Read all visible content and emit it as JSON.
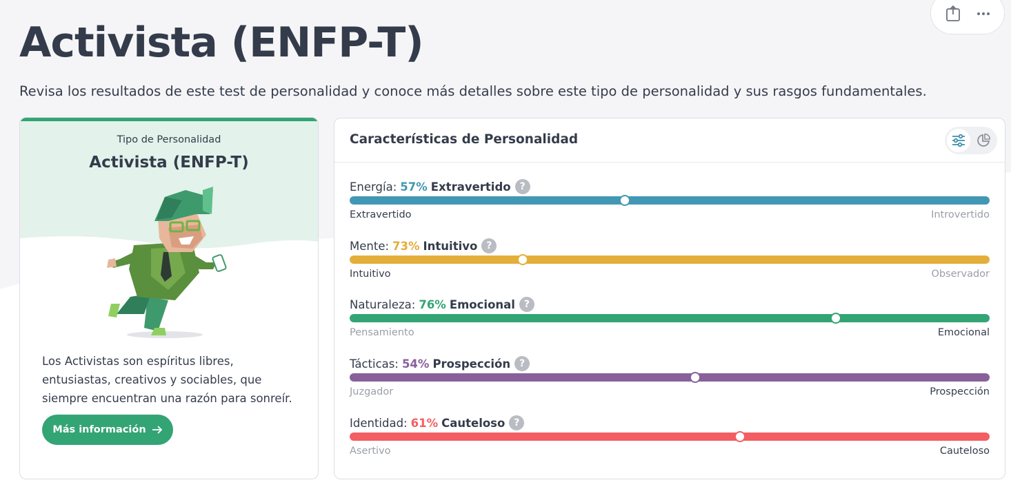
{
  "page": {
    "title": "Activista (ENFP-T)",
    "subtitle": "Revisa los resultados de este test de personalidad y conoce más detalles sobre este tipo de personalidad y sus rasgos fundamentales."
  },
  "top_actions": {
    "share_icon": "share-icon",
    "more_icon": "more-icon"
  },
  "type_card": {
    "label": "Tipo de Personalidad",
    "type_name": "Activista (ENFP-T)",
    "description": "Los Activistas son espíritus libres, entusiastas, creativos y sociables, que siempre encuentran una razón para sonreír.",
    "button_label": "Más información",
    "button_icon": "arrow-right-icon",
    "accent": "#33a474"
  },
  "traits_card": {
    "title": "Características de Personalidad",
    "view_icons": [
      "sliders-icon",
      "pie-chart-icon"
    ],
    "help_glyph": "?",
    "traits": [
      {
        "category": "Energía:",
        "percent": "57%",
        "trait": "Extravertido",
        "left": "Extravertido",
        "right": "Introvertido",
        "active_side": "left",
        "knob_position": 0.43,
        "color": "#4298b4"
      },
      {
        "category": "Mente:",
        "percent": "73%",
        "trait": "Intuitivo",
        "left": "Intuitivo",
        "right": "Observador",
        "active_side": "left",
        "knob_position": 0.27,
        "color": "#e4ae3a"
      },
      {
        "category": "Naturaleza:",
        "percent": "76%",
        "trait": "Emocional",
        "left": "Pensamiento",
        "right": "Emocional",
        "active_side": "right",
        "knob_position": 0.76,
        "color": "#33a474"
      },
      {
        "category": "Tácticas:",
        "percent": "54%",
        "trait": "Prospección",
        "left": "Juzgador",
        "right": "Prospección",
        "active_side": "right",
        "knob_position": 0.54,
        "color": "#88619a"
      },
      {
        "category": "Identidad:",
        "percent": "61%",
        "trait": "Cauteloso",
        "left": "Asertivo",
        "right": "Cauteloso",
        "active_side": "right",
        "knob_position": 0.61,
        "color": "#f25e62"
      }
    ]
  }
}
